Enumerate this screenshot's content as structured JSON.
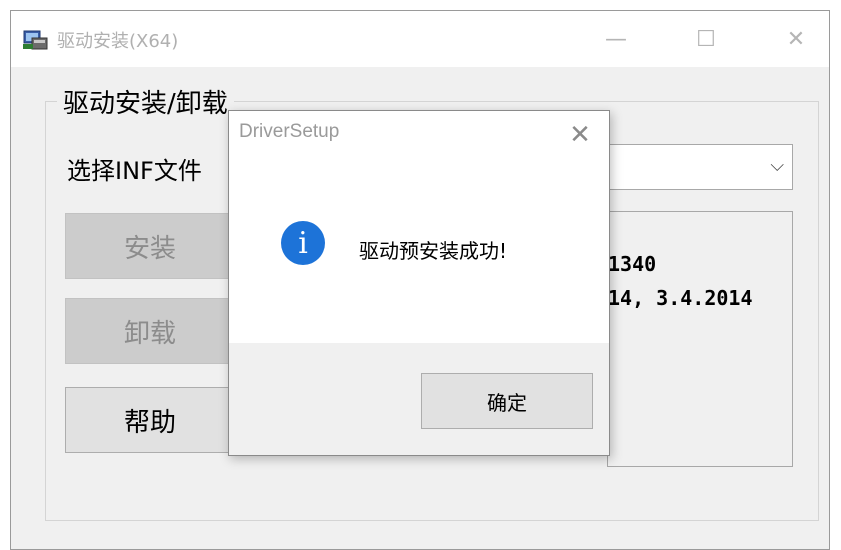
{
  "window": {
    "title": "驱动安装(X64)",
    "minimize_glyph": "—",
    "maximize_glyph": "☐",
    "close_glyph": "✕"
  },
  "group": {
    "title": "驱动安装/卸载",
    "inf_label": "选择INF文件",
    "install_label": "安装",
    "uninstall_label": "卸载",
    "help_label": "帮助",
    "select_chevron": "⌵",
    "info_line_1": "1340",
    "info_line_2": "14, 3.4.2014"
  },
  "dialog": {
    "title": "DriverSetup",
    "close_glyph": "✕",
    "icon_glyph": "i",
    "message": "驱动预安装成功!",
    "ok_label": "确定"
  },
  "colors": {
    "info_icon": "#1d73d8",
    "window_bg": "#f0f0f0",
    "disabled_button": "#cccccc"
  }
}
